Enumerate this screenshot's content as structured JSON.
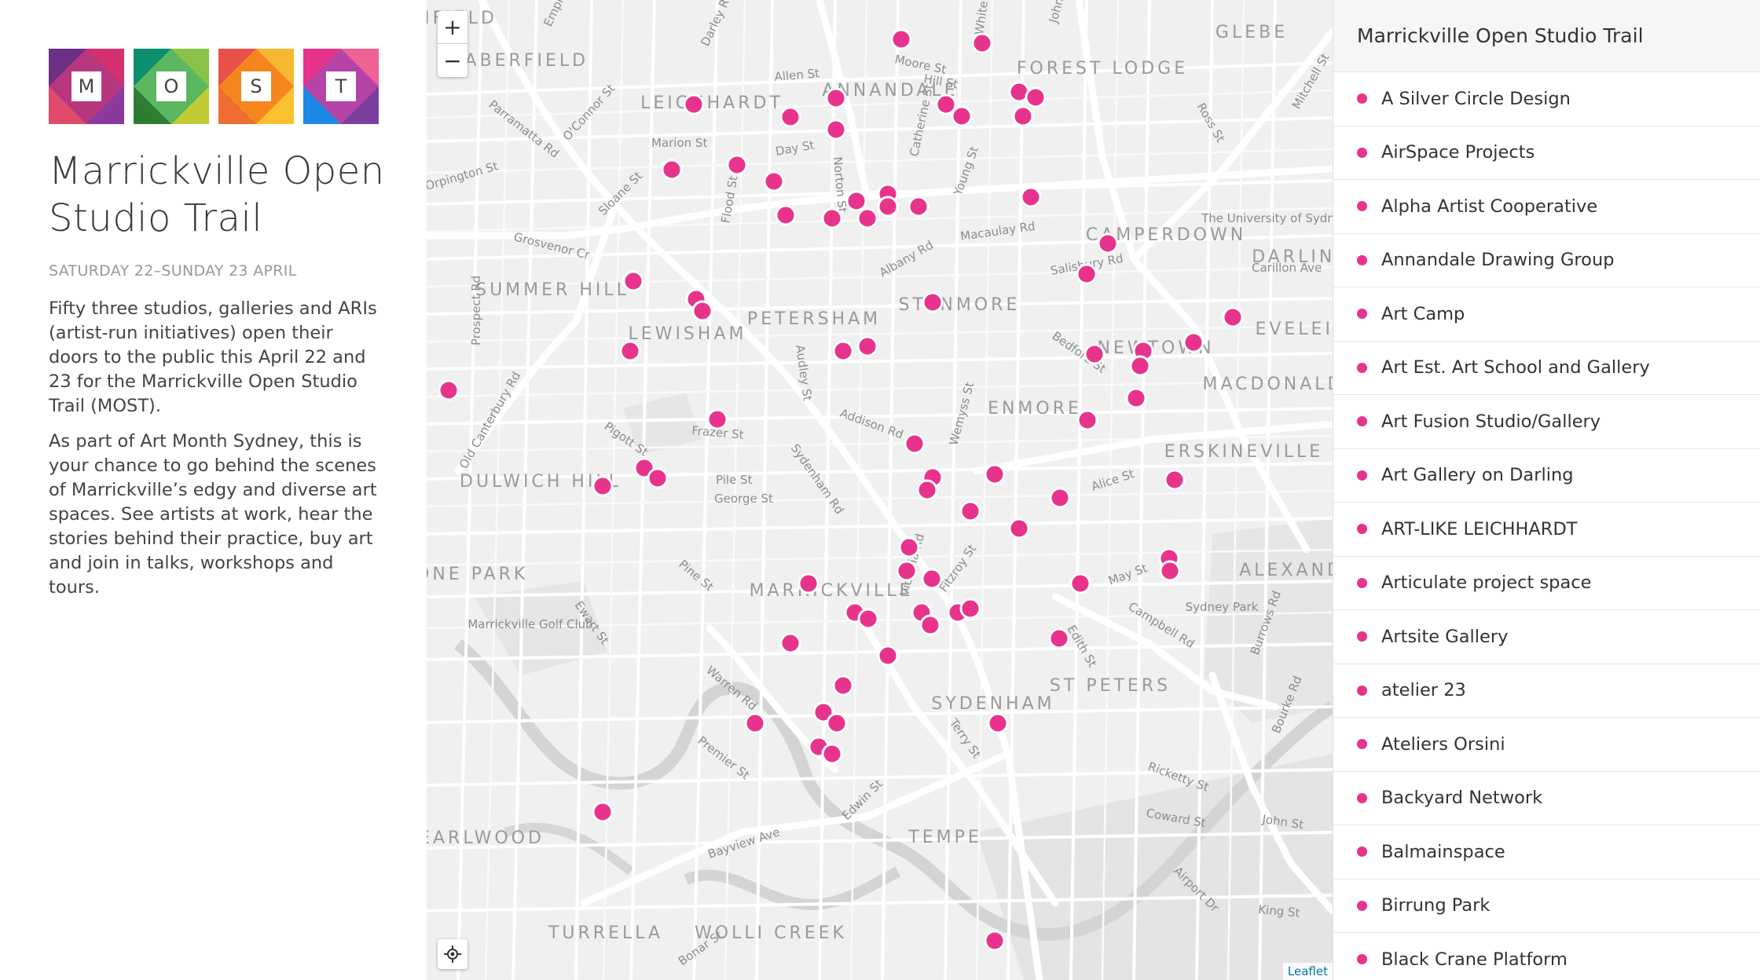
{
  "logo": {
    "letters": [
      "M",
      "O",
      "S",
      "T"
    ]
  },
  "intro": {
    "title": "Marrickville Open Studio Trail",
    "dates": "SATURDAY 22–SUNDAY 23 APRIL",
    "paragraph_1": "Fifty three studios, galleries and ARIs (artist-run initiatives) open their doors to the public this April 22 and 23 for the Marrickville Open Studio Trail (MOST).",
    "paragraph_2": "As part of Art Month Sydney, this is your chance to go behind the scenes of Marrickville’s edgy and diverse art spaces. See artists at work, hear the stories behind their practice, buy art and join in talks, workshops and tours."
  },
  "map": {
    "zoom_in_label": "+",
    "zoom_out_label": "−",
    "attribution": "Leaflet",
    "marker_color": "#e8338c",
    "suburbs": [
      "HABERFIELD",
      "LEICHHARDT",
      "ANNANDALE",
      "FOREST LODGE",
      "GLEBE",
      "CAMPERDOWN",
      "DARLINGTON",
      "SUMMER HILL",
      "LEWISHAM",
      "PETERSHAM",
      "STANMORE",
      "NEWTOWN",
      "EVELEIGH",
      "MACDONALDTOWN",
      "ENMORE",
      "ERSKINEVILLE",
      "DULWICH HILL",
      "MARRICKVILLE",
      "ALEXANDRIA",
      "ASHFIELD",
      "STONE PARK",
      "ST PETERS",
      "SYDENHAM",
      "EARLWOOD",
      "TEMPE",
      "TURRELLA",
      "WOLLI CREEK",
      "The University of Sydney",
      "Sydney Park",
      "Marrickville Golf Club"
    ],
    "streets": [
      "Allen St",
      "Moore St",
      "Hill St",
      "Marion St",
      "Day St",
      "Norton St",
      "Catherine St",
      "Young St",
      "Parramatta Rd",
      "O'Connor St",
      "Orpington St",
      "Sloane St",
      "Flood St",
      "Grosvenor Cr",
      "Macaulay Rd",
      "Albany Rd",
      "Salisbury Rd",
      "Carillon Ave",
      "Prospect Rd",
      "Audley St",
      "Bedford St",
      "Addison Rd",
      "Wemyss St",
      "Old Canterbury Rd",
      "Victoria Rd",
      "Pigott St",
      "Frazer St",
      "Pile St",
      "George St",
      "Sydenham Rd",
      "Alice St",
      "Pine St",
      "May St",
      "Campbell Rd",
      "Ewart St",
      "Fitzroy St",
      "Edith St",
      "Burrows Rd",
      "Warren Rd",
      "Premier St",
      "Terry St",
      "Bourke Rd",
      "Ricketty St",
      "Coward St",
      "John St",
      "Edwin St",
      "Bayview Ave",
      "Airport Dr",
      "King St",
      "Bonar St",
      "Empire St",
      "Darley Rd",
      "Ross St",
      "Mitchell St",
      "White St",
      "Johnston St"
    ]
  },
  "list": {
    "header": "Marrickville Open Studio Trail",
    "items": [
      "A Silver Circle Design",
      "AirSpace Projects",
      "Alpha Artist Cooperative",
      "Annandale Drawing Group",
      "Art Camp",
      "Art Est. Art School and Gallery",
      "Art Fusion Studio/Gallery",
      "Art Gallery on Darling",
      "ART-LIKE LEICHHARDT",
      "Articulate project space",
      "Artsite Gallery",
      "atelier 23",
      "Ateliers Orsini",
      "Backyard Network",
      "Balmainspace",
      "Birrung Park",
      "Black Crane Platform"
    ]
  }
}
